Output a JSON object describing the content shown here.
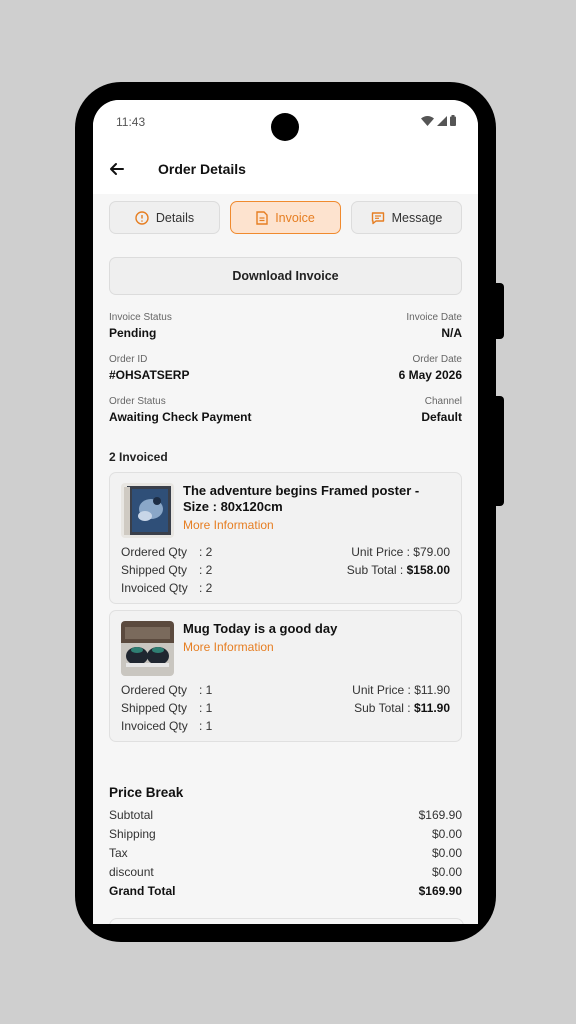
{
  "status_bar": {
    "time": "11:43"
  },
  "app_bar": {
    "title": "Order Details"
  },
  "tabs": [
    {
      "label": "Details"
    },
    {
      "label": "Invoice",
      "active": true
    },
    {
      "label": "Message"
    }
  ],
  "download_button": "Download Invoice",
  "invoice_info": {
    "invoice_status_label": "Invoice Status",
    "invoice_status": "Pending",
    "invoice_date_label": "Invoice Date",
    "invoice_date": "N/A",
    "order_id_label": "Order ID",
    "order_id": "#OHSATSERP",
    "order_date_label": "Order Date",
    "order_date": "6 May 2026",
    "order_status_label": "Order Status",
    "order_status": "Awaiting Check Payment",
    "channel_label": "Channel",
    "channel": "Default"
  },
  "invoiced_count": "2 Invoiced",
  "items": [
    {
      "name": "The adventure begins Framed poster - Size : 80x120cm",
      "more": "More Information",
      "ordered_label": "Ordered Qty",
      "ordered": ": 2",
      "shipped_label": "Shipped Qty",
      "shipped": ": 2",
      "invoiced_label": "Invoiced Qty",
      "invoiced": ": 2",
      "unit_price_label": "Unit Price :",
      "unit_price": "$79.00",
      "subtotal_label": "Sub Total :",
      "subtotal": "$158.00"
    },
    {
      "name": "Mug Today is a good day",
      "more": "More Information",
      "ordered_label": "Ordered Qty",
      "ordered": ": 1",
      "shipped_label": "Shipped Qty",
      "shipped": ": 1",
      "invoiced_label": "Invoiced Qty",
      "invoiced": ": 1",
      "unit_price_label": "Unit Price :",
      "unit_price": "$11.90",
      "subtotal_label": "Sub Total :",
      "subtotal": "$11.90"
    }
  ],
  "price_break": {
    "title": "Price Break",
    "rows": [
      {
        "label": "Subtotal",
        "value": "$169.90"
      },
      {
        "label": "Shipping",
        "value": "$0.00"
      },
      {
        "label": "Tax",
        "value": "$0.00"
      },
      {
        "label": "discount",
        "value": "$0.00"
      },
      {
        "label": "Grand Total",
        "value": "$169.90"
      }
    ]
  },
  "colors": {
    "accent": "#e67e22",
    "active_tab_bg": "#fde3cf"
  },
  "icons": [
    "back-arrow-icon",
    "info-icon",
    "document-icon",
    "message-icon",
    "wifi-icon",
    "signal-icon",
    "battery-icon"
  ]
}
